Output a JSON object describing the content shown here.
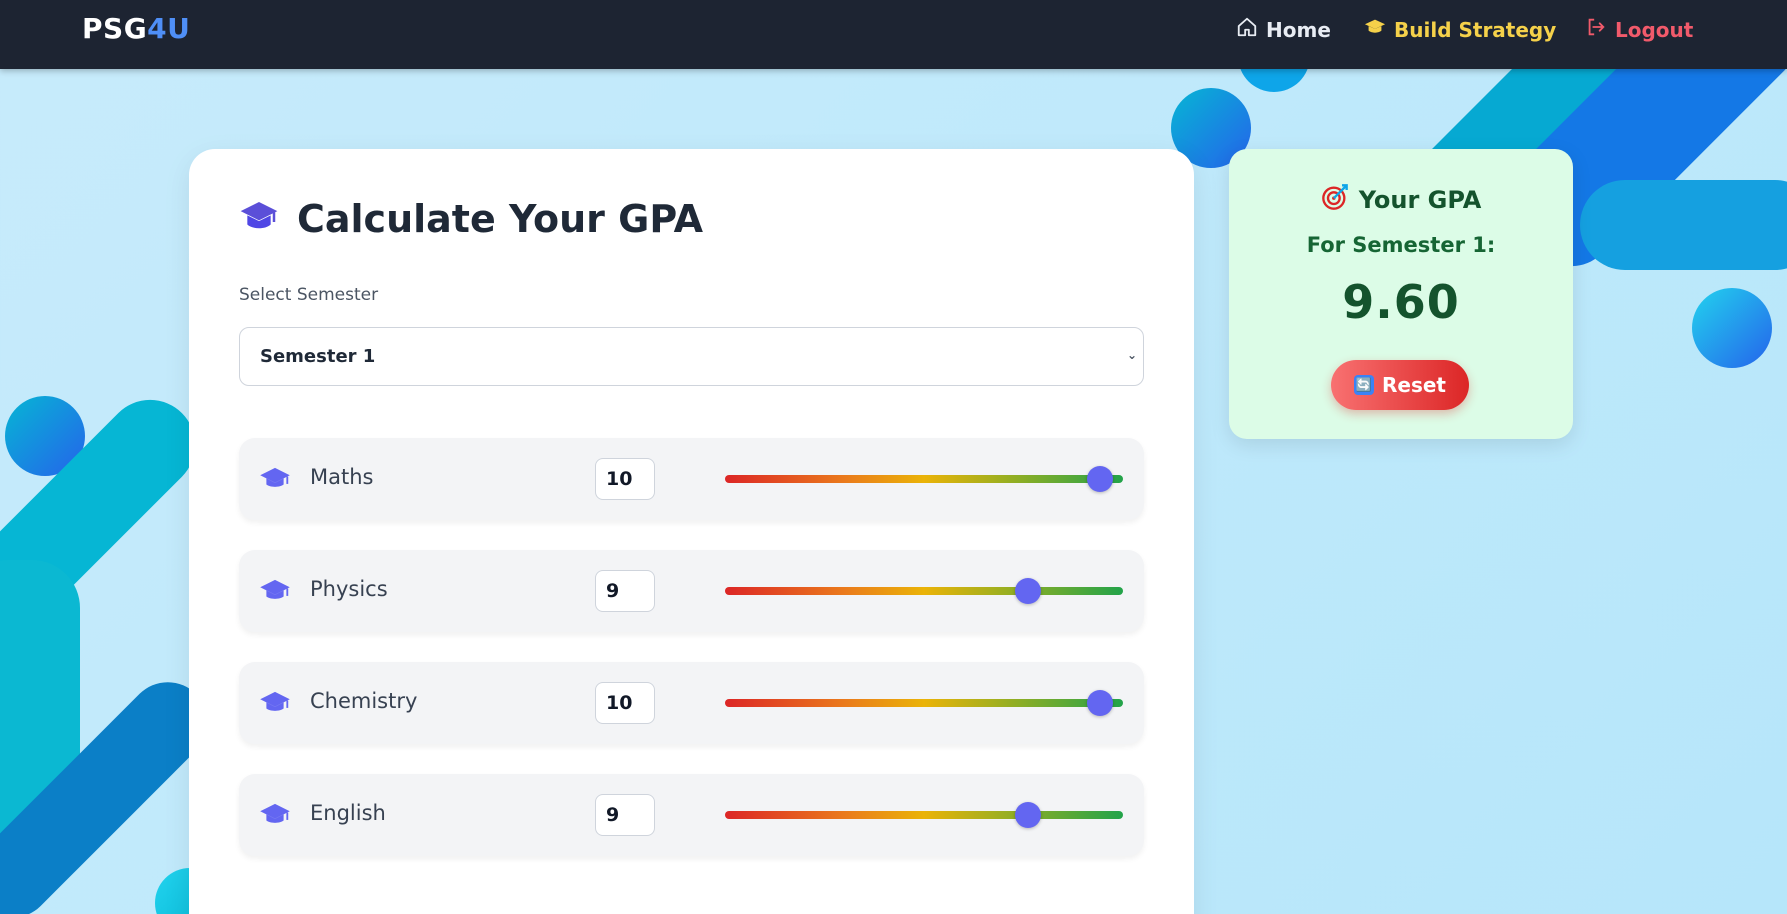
{
  "navbar": {
    "brand_part1": "PSG",
    "brand_part2": "4U",
    "links": [
      {
        "label": "Home",
        "icon": "home-icon"
      },
      {
        "label": "Build Strategy",
        "icon": "graduation-cap-icon"
      },
      {
        "label": "Logout",
        "icon": "logout-icon"
      }
    ]
  },
  "main": {
    "title": "Calculate Your GPA",
    "title_icon": "graduation-cap-icon",
    "semester_label": "Select Semester",
    "semester_selected": "Semester 1",
    "subjects": [
      {
        "name": "Maths",
        "grade": "10",
        "slider_fraction": 1.0
      },
      {
        "name": "Physics",
        "grade": "9",
        "slider_fraction": 0.8
      },
      {
        "name": "Chemistry",
        "grade": "10",
        "slider_fraction": 1.0
      },
      {
        "name": "English",
        "grade": "9",
        "slider_fraction": 0.8
      }
    ]
  },
  "gpa": {
    "heading": "Your GPA",
    "heading_icon": "target-icon",
    "subtitle": "For Semester 1:",
    "value": "9.60",
    "reset_label": "Reset",
    "reset_icon": "refresh-icon"
  },
  "colors": {
    "navbar_bg": "#1d2432",
    "brand_accent": "#4f8ff7",
    "build_strategy": "#f5d14a",
    "logout": "#f15a6b",
    "slider_thumb": "#6366f1",
    "gpa_card_bg": "#dcfce7",
    "reset_button": "#dc2626"
  }
}
